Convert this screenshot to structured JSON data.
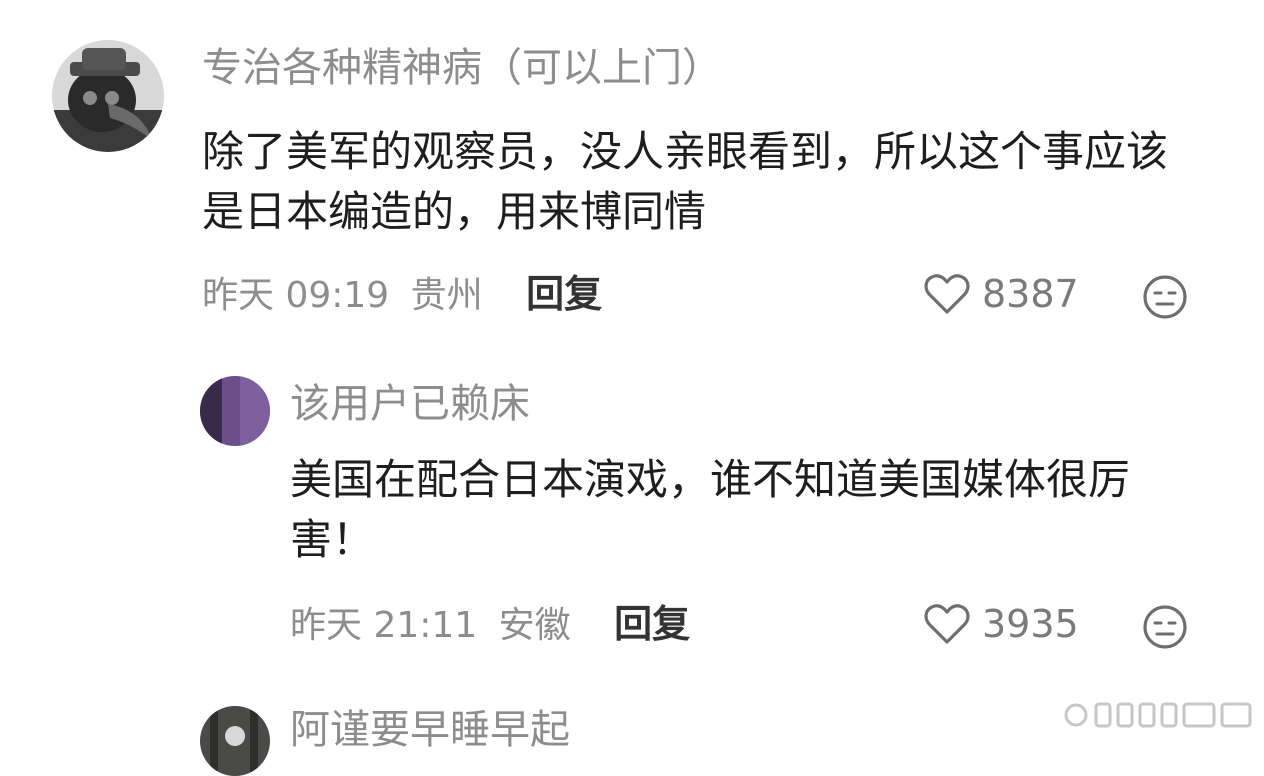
{
  "comments": [
    {
      "username": "专治各种精神病（可以上门）",
      "text": "除了美军的观察员，没人亲眼看到，所以这个事应该是日本编造的，用来博同情",
      "time": "昨天 09:19",
      "location": "贵州",
      "reply_label": "回复",
      "likes": "8387",
      "avatar_icon": "plague-doctor-mask-avatar"
    },
    {
      "username": "该用户已赖床",
      "text": "美国在配合日本演戏，谁不知道美国媒体很厉害！",
      "time": "昨天 21:11",
      "location": "安徽",
      "reply_label": "回复",
      "likes": "3935",
      "avatar_icon": "purple-avatar"
    },
    {
      "username": "阿谨要早睡早起",
      "avatar_icon": "dark-photo-avatar"
    }
  ],
  "icons": {
    "like": "heart-outline-icon",
    "dislike": "neutral-face-icon"
  },
  "colors": {
    "username": "#8d8d8d",
    "body_text": "#1e1e1e",
    "meta": "#8d8d8d",
    "reply": "#333333",
    "like_count": "#7a7a7a"
  }
}
